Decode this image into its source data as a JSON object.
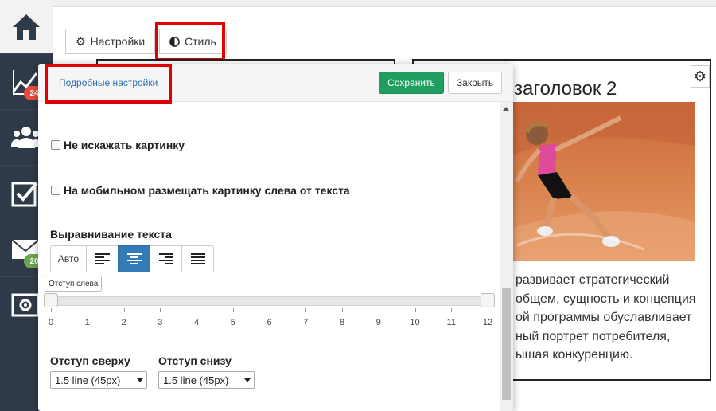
{
  "sidebar": {
    "items": [
      {
        "icon": "home-icon"
      },
      {
        "icon": "chart-up-icon",
        "badge": "24",
        "badge_color": "#e74c3c"
      },
      {
        "icon": "users-icon"
      },
      {
        "icon": "checkbox-icon"
      },
      {
        "icon": "mail-icon",
        "badge": "20",
        "badge_color": "#6aa84f"
      },
      {
        "icon": "settings-box-icon"
      }
    ]
  },
  "tabs": {
    "settings_label": "Настройки",
    "style_label": "Стиль"
  },
  "panel": {
    "advanced_link": "Подробные настройки",
    "save_label": "Сохранить",
    "close_label": "Закрыть",
    "checkboxes": [
      "Не искажать картинку",
      "На мобильном размещать картинку слева от текста"
    ],
    "align_label": "Выравнивание текста",
    "align_options": {
      "auto_label": "Авто",
      "selected": "center"
    },
    "indent_left_tooltip": "Отступ слева",
    "slider": {
      "min": 0,
      "max": 12,
      "value": 0,
      "ticks": [
        "0",
        "1",
        "2",
        "3",
        "4",
        "5",
        "6",
        "7",
        "8",
        "9",
        "10",
        "11",
        "12"
      ]
    },
    "margin_top_label": "Отступ сверху",
    "margin_bottom_label": "Отступ снизу",
    "margin_top_value": "1.5 line (45px)",
    "margin_bottom_value": "1.5 line (45px)"
  },
  "content": {
    "heading": "заголовок 2",
    "paragraph": [
      "развивает стратегический",
      "общем, сущность и концепция",
      "ой программы обуславливает",
      "ный портрет потребителя,",
      "ышая конкуренцию."
    ]
  },
  "colors": {
    "accent_red": "#e00000",
    "save_green": "#1f9e60",
    "active_blue": "#337ab7",
    "sidebar_bg": "#2f3a48"
  }
}
